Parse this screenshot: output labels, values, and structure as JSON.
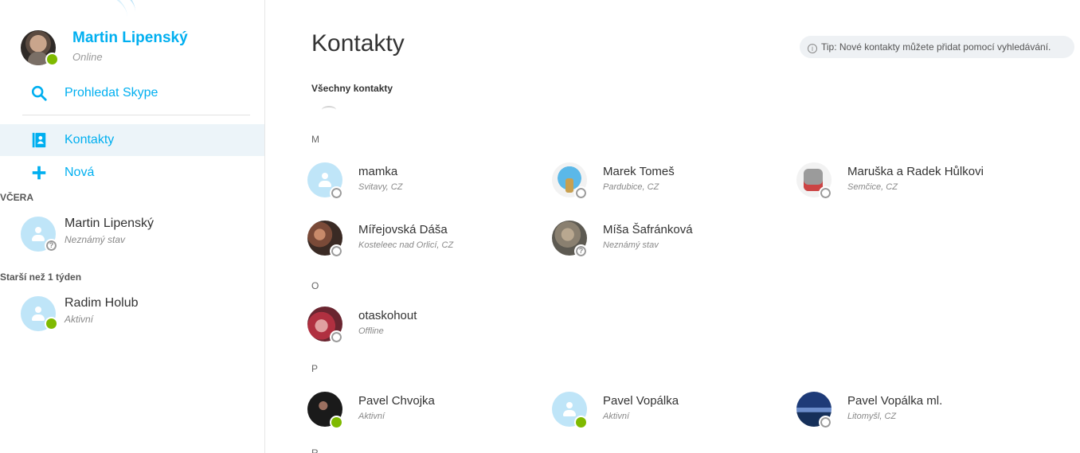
{
  "sidebar": {
    "profile": {
      "name": "Martin Lipenský",
      "mood": "Online"
    },
    "search_label": "Prohledat Skype",
    "nav": [
      {
        "label": "Kontakty",
        "icon": "contacts-book-icon",
        "selected": true
      },
      {
        "label": "Nová",
        "icon": "plus-icon"
      }
    ],
    "recent_groups": [
      {
        "header": "VČERA",
        "items": [
          {
            "name": "Martin Lipenský",
            "status": "Neznámý stav",
            "presence": "unknown"
          }
        ]
      },
      {
        "header": "Starší než 1 týden",
        "items": [
          {
            "name": "Radim Holub",
            "status": "Aktivní",
            "presence": "online"
          }
        ]
      }
    ]
  },
  "main": {
    "title": "Kontakty",
    "tip": "Tip: Nové kontakty můžete přidat pomocí vyhledávání.",
    "list_title": "Všechny kontakty",
    "sections": [
      {
        "letter": "M",
        "contacts": [
          {
            "name": "mamka",
            "sub": "Svitavy, CZ",
            "presence": "offline",
            "avatar": "default"
          },
          {
            "name": "Marek Tomeš",
            "sub": "Pardubice, CZ",
            "presence": "offline",
            "avatar": "skype"
          },
          {
            "name": "Maruška a Radek Hůlkovi",
            "sub": "Semčice, CZ",
            "presence": "offline",
            "avatar": "gray"
          },
          {
            "name": "Mířejovská Dáša",
            "sub": "Kosteleec nad Orlicí, CZ",
            "presence": "offline",
            "avatar": "photo1"
          },
          {
            "name": "Míša Šafránková",
            "sub": "Neznámý stav",
            "presence": "unknown",
            "avatar": "photo2"
          }
        ]
      },
      {
        "letter": "O",
        "contacts": [
          {
            "name": "otaskohout",
            "sub": "Offline",
            "presence": "offline",
            "avatar": "photo3"
          }
        ]
      },
      {
        "letter": "P",
        "contacts": [
          {
            "name": "Pavel Chvojka",
            "sub": "Aktivní",
            "presence": "online",
            "avatar": "photo4"
          },
          {
            "name": "Pavel Vopálka",
            "sub": "Aktivní",
            "presence": "online",
            "avatar": "default"
          },
          {
            "name": "Pavel Vopálka ml.",
            "sub": "Litomyšl, CZ",
            "presence": "offline",
            "avatar": "photo5"
          }
        ]
      },
      {
        "letter": "R",
        "contacts": []
      }
    ]
  },
  "colors": {
    "accent": "#00aff0",
    "online": "#7fba00",
    "selected_bg": "#ecf4f9"
  }
}
